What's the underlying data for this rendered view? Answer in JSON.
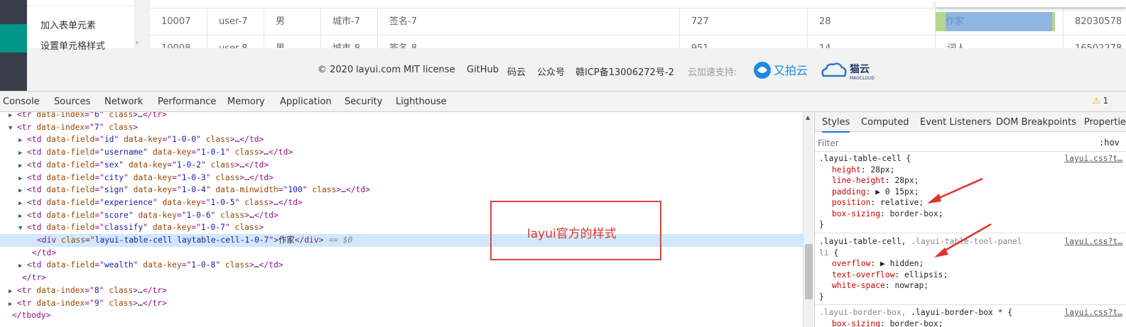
{
  "page": {
    "sidenav": {
      "items": [
        "加入表单元素",
        "设置单元格样式"
      ]
    },
    "table": {
      "rows": [
        [
          "10007",
          "user-7",
          "男",
          "城市-7",
          "签名-7",
          "727",
          "28",
          "作家",
          "82030578"
        ],
        [
          "10008",
          "user-8",
          "男",
          "城市-8",
          "签名-8",
          "951",
          "14",
          "词人",
          "16502278"
        ]
      ],
      "highlight_text": "作家"
    },
    "footer": {
      "copyright": "© 2020",
      "site": "layui.com",
      "license": "MIT license",
      "github": "GitHub",
      "gitee": "码云",
      "wechat": "公众号",
      "icp": "赣ICP备13006272号-2",
      "cdn_label": "云加速支持:",
      "upyun": "又拍云",
      "maocloud": "猫云",
      "maocloud_sub": "MAOCLOUD"
    }
  },
  "devtools": {
    "tabs": [
      "Console",
      "Sources",
      "Network",
      "Performance",
      "Memory",
      "Application",
      "Security",
      "Lighthouse"
    ],
    "warnings": "1",
    "elements": {
      "lines": [
        {
          "indent": 2,
          "tri": "▶",
          "parts": [
            [
              "tag",
              "<tr "
            ],
            [
              "attr",
              "data-index"
            ],
            [
              "tag",
              "=\""
            ],
            [
              "val",
              "6"
            ],
            [
              "tag",
              "\" "
            ],
            [
              "attr",
              "class"
            ],
            [
              "tag",
              ">"
            ],
            [
              "txtc",
              "…"
            ],
            [
              "tag",
              "</tr>"
            ]
          ]
        },
        {
          "indent": 2,
          "tri": "▼",
          "parts": [
            [
              "tag",
              "<tr "
            ],
            [
              "attr",
              "data-index"
            ],
            [
              "tag",
              "=\""
            ],
            [
              "val",
              "7"
            ],
            [
              "tag",
              "\" "
            ],
            [
              "attr",
              "class"
            ],
            [
              "tag",
              ">"
            ]
          ]
        },
        {
          "indent": 4,
          "tri": "▶",
          "parts": [
            [
              "tag",
              "<td "
            ],
            [
              "attr",
              "data-field"
            ],
            [
              "tag",
              "=\""
            ],
            [
              "val",
              "id"
            ],
            [
              "tag",
              "\" "
            ],
            [
              "attr",
              "data-key"
            ],
            [
              "tag",
              "=\""
            ],
            [
              "val",
              "1-0-0"
            ],
            [
              "tag",
              "\" "
            ],
            [
              "attr",
              "class"
            ],
            [
              "tag",
              ">"
            ],
            [
              "txtc",
              "…"
            ],
            [
              "tag",
              "</td>"
            ]
          ]
        },
        {
          "indent": 4,
          "tri": "▶",
          "parts": [
            [
              "tag",
              "<td "
            ],
            [
              "attr",
              "data-field"
            ],
            [
              "tag",
              "=\""
            ],
            [
              "val",
              "username"
            ],
            [
              "tag",
              "\" "
            ],
            [
              "attr",
              "data-key"
            ],
            [
              "tag",
              "=\""
            ],
            [
              "val",
              "1-0-1"
            ],
            [
              "tag",
              "\" "
            ],
            [
              "attr",
              "class"
            ],
            [
              "tag",
              ">"
            ],
            [
              "txtc",
              "…"
            ],
            [
              "tag",
              "</td>"
            ]
          ]
        },
        {
          "indent": 4,
          "tri": "▶",
          "parts": [
            [
              "tag",
              "<td "
            ],
            [
              "attr",
              "data-field"
            ],
            [
              "tag",
              "=\""
            ],
            [
              "val",
              "sex"
            ],
            [
              "tag",
              "\" "
            ],
            [
              "attr",
              "data-key"
            ],
            [
              "tag",
              "=\""
            ],
            [
              "val",
              "1-0-2"
            ],
            [
              "tag",
              "\" "
            ],
            [
              "attr",
              "class"
            ],
            [
              "tag",
              ">"
            ],
            [
              "txtc",
              "…"
            ],
            [
              "tag",
              "</td>"
            ]
          ]
        },
        {
          "indent": 4,
          "tri": "▶",
          "parts": [
            [
              "tag",
              "<td "
            ],
            [
              "attr",
              "data-field"
            ],
            [
              "tag",
              "=\""
            ],
            [
              "val",
              "city"
            ],
            [
              "tag",
              "\" "
            ],
            [
              "attr",
              "data-key"
            ],
            [
              "tag",
              "=\""
            ],
            [
              "val",
              "1-0-3"
            ],
            [
              "tag",
              "\" "
            ],
            [
              "attr",
              "class"
            ],
            [
              "tag",
              ">"
            ],
            [
              "txtc",
              "…"
            ],
            [
              "tag",
              "</td>"
            ]
          ]
        },
        {
          "indent": 4,
          "tri": "▶",
          "parts": [
            [
              "tag",
              "<td "
            ],
            [
              "attr",
              "data-field"
            ],
            [
              "tag",
              "=\""
            ],
            [
              "val",
              "sign"
            ],
            [
              "tag",
              "\" "
            ],
            [
              "attr",
              "data-key"
            ],
            [
              "tag",
              "=\""
            ],
            [
              "val",
              "1-0-4"
            ],
            [
              "tag",
              "\" "
            ],
            [
              "attr",
              "data-minwidth"
            ],
            [
              "tag",
              "=\""
            ],
            [
              "val",
              "100"
            ],
            [
              "tag",
              "\" "
            ],
            [
              "attr",
              "class"
            ],
            [
              "tag",
              ">"
            ],
            [
              "txtc",
              "…"
            ],
            [
              "tag",
              "</td>"
            ]
          ]
        },
        {
          "indent": 4,
          "tri": "▶",
          "parts": [
            [
              "tag",
              "<td "
            ],
            [
              "attr",
              "data-field"
            ],
            [
              "tag",
              "=\""
            ],
            [
              "val",
              "experience"
            ],
            [
              "tag",
              "\" "
            ],
            [
              "attr",
              "data-key"
            ],
            [
              "tag",
              "=\""
            ],
            [
              "val",
              "1-0-5"
            ],
            [
              "tag",
              "\" "
            ],
            [
              "attr",
              "class"
            ],
            [
              "tag",
              ">"
            ],
            [
              "txtc",
              "…"
            ],
            [
              "tag",
              "</td>"
            ]
          ]
        },
        {
          "indent": 4,
          "tri": "▶",
          "parts": [
            [
              "tag",
              "<td "
            ],
            [
              "attr",
              "data-field"
            ],
            [
              "tag",
              "=\""
            ],
            [
              "val",
              "score"
            ],
            [
              "tag",
              "\" "
            ],
            [
              "attr",
              "data-key"
            ],
            [
              "tag",
              "=\""
            ],
            [
              "val",
              "1-0-6"
            ],
            [
              "tag",
              "\" "
            ],
            [
              "attr",
              "class"
            ],
            [
              "tag",
              ">"
            ],
            [
              "txtc",
              "…"
            ],
            [
              "tag",
              "</td>"
            ]
          ]
        },
        {
          "indent": 4,
          "tri": "▼",
          "parts": [
            [
              "tag",
              "<td "
            ],
            [
              "attr",
              "data-field"
            ],
            [
              "tag",
              "=\""
            ],
            [
              "val",
              "classify"
            ],
            [
              "tag",
              "\" "
            ],
            [
              "attr",
              "data-key"
            ],
            [
              "tag",
              "=\""
            ],
            [
              "val",
              "1-0-7"
            ],
            [
              "tag",
              "\" "
            ],
            [
              "attr",
              "class"
            ],
            [
              "tag",
              ">"
            ]
          ]
        },
        {
          "indent": 6,
          "tri": "",
          "selected": true,
          "parts": [
            [
              "tag",
              "<div "
            ],
            [
              "attr",
              "class"
            ],
            [
              "tag",
              "=\""
            ],
            [
              "val",
              "layui-table-cell laytable-cell-1-0-7"
            ],
            [
              "tag",
              "\">"
            ],
            [
              "txtc",
              "作家"
            ],
            [
              "tag",
              "</div>"
            ],
            [
              "cmt",
              " == $0"
            ]
          ]
        },
        {
          "indent": 5,
          "tri": "",
          "parts": [
            [
              "tag",
              "</td>"
            ]
          ]
        },
        {
          "indent": 4,
          "tri": "▶",
          "parts": [
            [
              "tag",
              "<td "
            ],
            [
              "attr",
              "data-field"
            ],
            [
              "tag",
              "=\""
            ],
            [
              "val",
              "wealth"
            ],
            [
              "tag",
              "\" "
            ],
            [
              "attr",
              "data-key"
            ],
            [
              "tag",
              "=\""
            ],
            [
              "val",
              "1-0-8"
            ],
            [
              "tag",
              "\" "
            ],
            [
              "attr",
              "class"
            ],
            [
              "tag",
              ">"
            ],
            [
              "txtc",
              "…"
            ],
            [
              "tag",
              "</td>"
            ]
          ]
        },
        {
          "indent": 3,
          "tri": "",
          "parts": [
            [
              "tag",
              "</tr>"
            ]
          ]
        },
        {
          "indent": 2,
          "tri": "▶",
          "parts": [
            [
              "tag",
              "<tr "
            ],
            [
              "attr",
              "data-index"
            ],
            [
              "tag",
              "=\""
            ],
            [
              "val",
              "8"
            ],
            [
              "tag",
              "\" "
            ],
            [
              "attr",
              "class"
            ],
            [
              "tag",
              ">"
            ],
            [
              "txtc",
              "…"
            ],
            [
              "tag",
              "</tr>"
            ]
          ]
        },
        {
          "indent": 2,
          "tri": "▶",
          "parts": [
            [
              "tag",
              "<tr "
            ],
            [
              "attr",
              "data-index"
            ],
            [
              "tag",
              "=\""
            ],
            [
              "val",
              "9"
            ],
            [
              "tag",
              "\" "
            ],
            [
              "attr",
              "class"
            ],
            [
              "tag",
              ">"
            ],
            [
              "txtc",
              "…"
            ],
            [
              "tag",
              "</tr>"
            ]
          ]
        },
        {
          "indent": 1,
          "tri": "",
          "parts": [
            [
              "tag",
              "</tbody>"
            ]
          ]
        }
      ]
    },
    "annotation": "layui官方的样式",
    "styles": {
      "tabs": [
        "Styles",
        "Computed",
        "Event Listeners",
        "DOM Breakpoints",
        "Properties"
      ],
      "filter_placeholder": "Filter",
      "hov": ":hov",
      "rules": [
        {
          "selector": [
            [
              "sel",
              ".layui-table-cell {"
            ]
          ],
          "source": "layui.css?t…",
          "props": [
            [
              "height",
              "28px"
            ],
            [
              "line-height",
              "28px"
            ],
            [
              "padding",
              "▶ 0 15px"
            ],
            [
              "position",
              "relative"
            ],
            [
              "box-sizing",
              "border-box"
            ]
          ]
        },
        {
          "selector": [
            [
              "sel",
              ".layui-table-cell, "
            ],
            [
              "dim",
              ".layui-table-tool-panel"
            ]
          ],
          "selector2": [
            [
              "dim",
              "li"
            ],
            [
              "sel",
              " {"
            ]
          ],
          "source": "layui.css?t…",
          "props": [
            [
              "overflow",
              "▶ hidden"
            ],
            [
              "text-overflow",
              "ellipsis"
            ],
            [
              "white-space",
              "nowrap"
            ]
          ]
        },
        {
          "selector": [
            [
              "dim",
              ".layui-border-box, "
            ],
            [
              "sel",
              ".layui-border-box * {"
            ]
          ],
          "source": "layui.css?t…",
          "props": [
            [
              "box-sizing",
              "border-box"
            ]
          ]
        }
      ]
    }
  }
}
